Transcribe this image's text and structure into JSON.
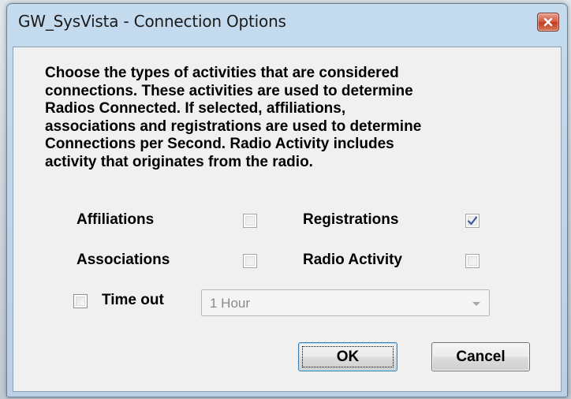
{
  "window": {
    "title": "GW_SysVista - Connection Options"
  },
  "description": "Choose the types of activities that are considered\nconnections.  These activities are used to determine\nRadios Connected.  If selected, affiliations,\nassociations and registrations are used to determine\nConnections per Second.  Radio Activity includes\nactivity that originates from the radio.",
  "options": {
    "affiliations": {
      "label": "Affiliations",
      "checked": false
    },
    "registrations": {
      "label": "Registrations",
      "checked": true
    },
    "associations": {
      "label": "Associations",
      "checked": false
    },
    "radio_activity": {
      "label": "Radio Activity",
      "checked": false
    }
  },
  "timeout": {
    "label": "Time out",
    "checked": false,
    "selected": "1 Hour"
  },
  "buttons": {
    "ok": "OK",
    "cancel": "Cancel"
  },
  "colors": {
    "accent": "#3c7fb1",
    "close_button": "#c23b1f",
    "check_mark": "#3c5a9a"
  },
  "icons": {
    "close": "close-icon",
    "check": "checkmark-icon",
    "dropdown": "chevron-down-icon"
  }
}
